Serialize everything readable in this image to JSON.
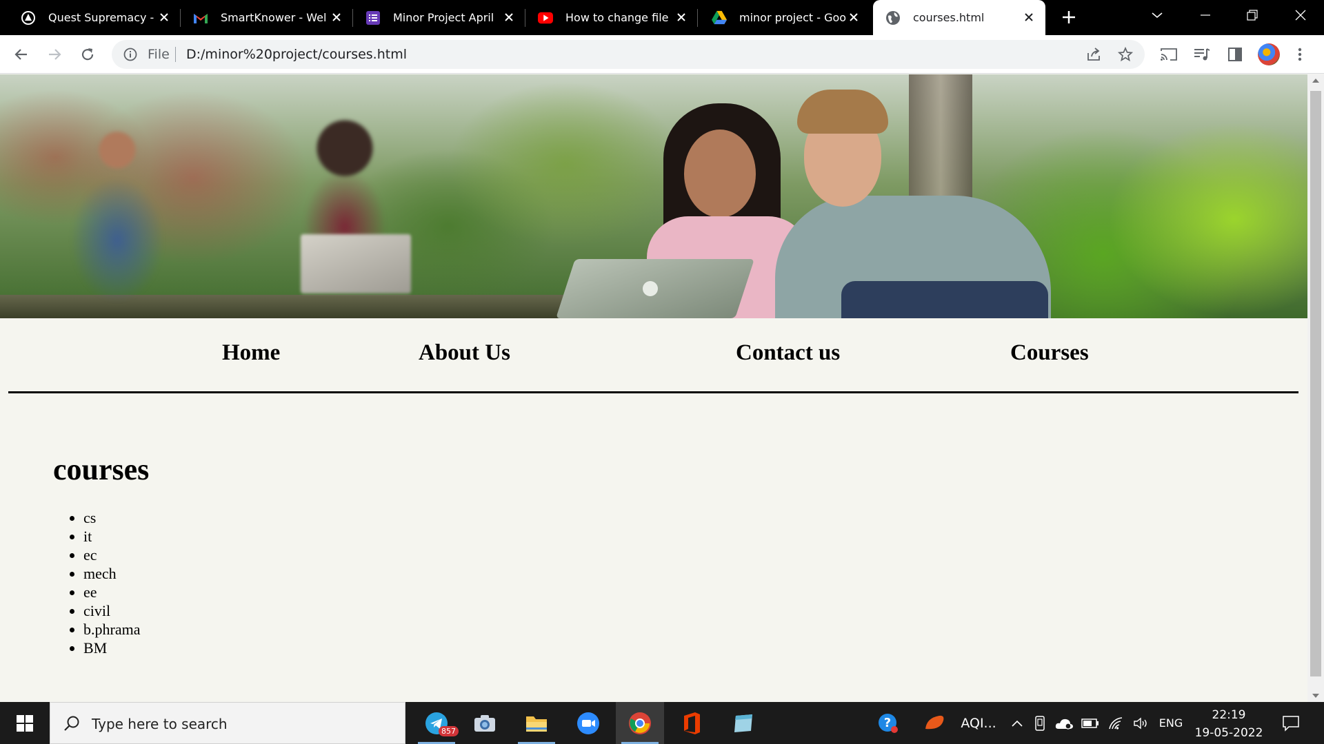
{
  "browser": {
    "tabs": [
      {
        "title": "Quest Supremacy -",
        "icon": "quest-icon"
      },
      {
        "title": "SmartKnower - Wel",
        "icon": "gmail-icon"
      },
      {
        "title": "Minor Project April",
        "icon": "forms-icon"
      },
      {
        "title": "How to change file",
        "icon": "youtube-icon"
      },
      {
        "title": "minor project - Goo",
        "icon": "drive-icon"
      },
      {
        "title": "courses.html",
        "icon": "globe-icon",
        "active": true
      }
    ],
    "omnibox": {
      "scheme_label": "File",
      "url": "D:/minor%20project/courses.html"
    }
  },
  "page": {
    "nav": [
      "Home",
      "About Us",
      "Contact us",
      "Courses"
    ],
    "heading": "courses",
    "courses": [
      "cs",
      "it",
      "ec",
      "mech",
      "ee",
      "civil",
      "b.phrama",
      "BM"
    ]
  },
  "taskbar": {
    "search_placeholder": "Type here to search",
    "telegram_badge": "857",
    "weather_label": "AQI...",
    "language": "ENG",
    "time": "22:19",
    "date": "19-05-2022"
  },
  "colors": {
    "tabstrip": "#000000",
    "page_bg": "#f5f5ef",
    "taskbar": "#1b1b1b"
  }
}
